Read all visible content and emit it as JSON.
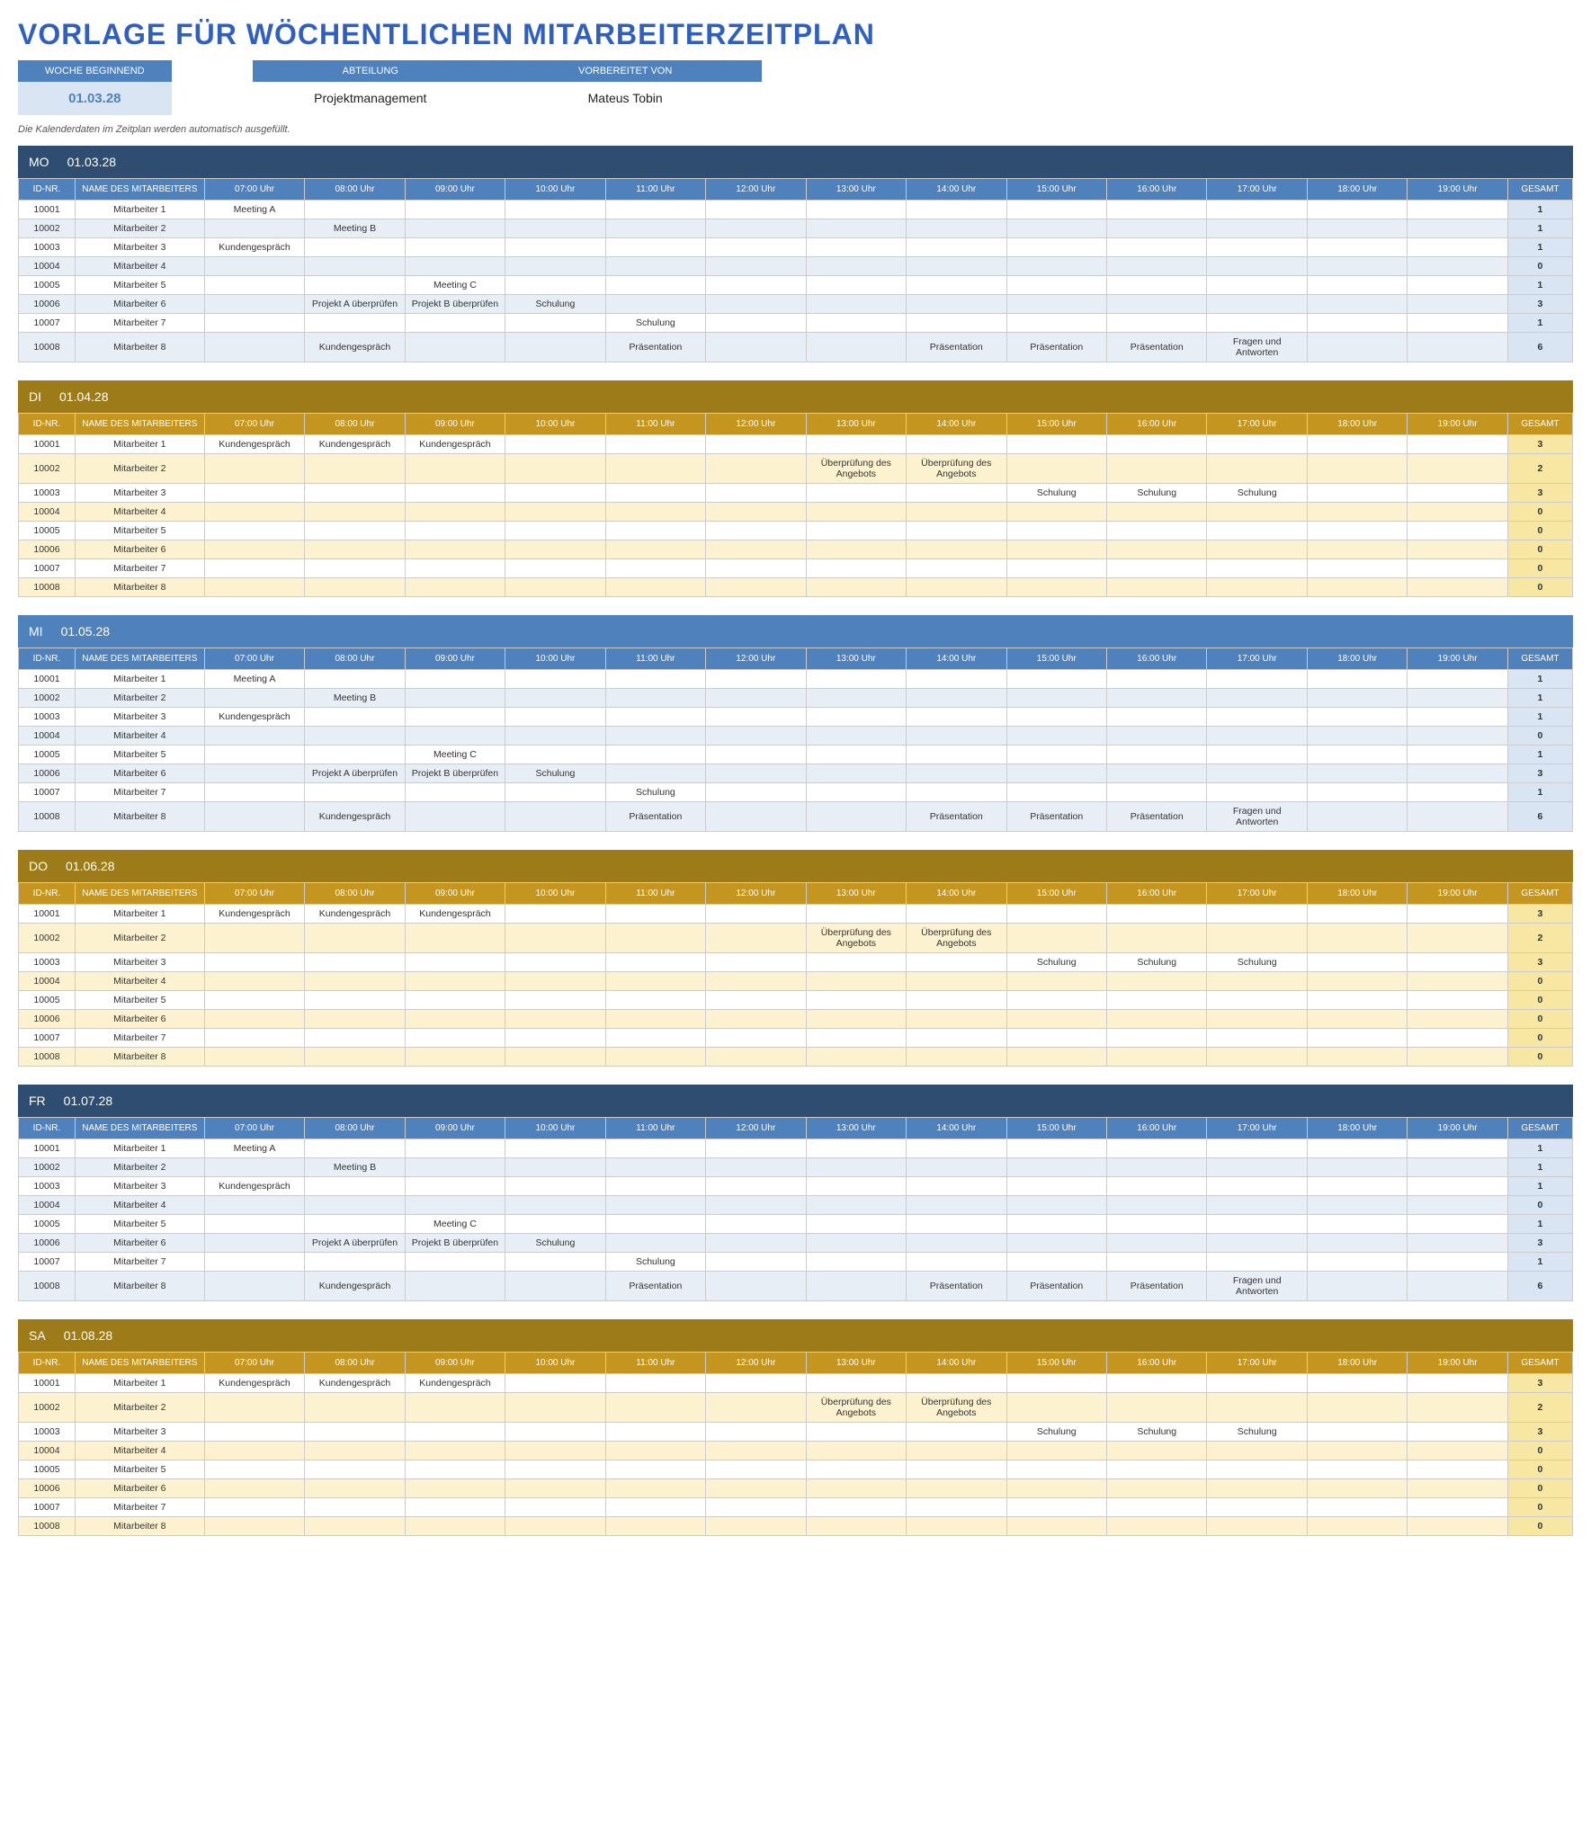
{
  "title": "VORLAGE FÜR WÖCHENTLICHEN MITARBEITERZEITPLAN",
  "header": {
    "week_label": "WOCHE BEGINNEND",
    "week_value": "01.03.28",
    "dept_label": "ABTEILUNG",
    "dept_value": "Projektmanagement",
    "prep_label": "VORBEREITET VON",
    "prep_value": "Mateus Tobin"
  },
  "note": "Die Kalenderdaten im Zeitplan werden automatisch ausgefüllt.",
  "columns": {
    "id": "ID-NR.",
    "name": "NAME DES MITARBEITERS",
    "hours": [
      "07:00 Uhr",
      "08:00 Uhr",
      "09:00 Uhr",
      "10:00 Uhr",
      "11:00 Uhr",
      "12:00 Uhr",
      "13:00 Uhr",
      "14:00 Uhr",
      "15:00 Uhr",
      "16:00 Uhr",
      "17:00 Uhr",
      "18:00 Uhr",
      "19:00 Uhr"
    ],
    "total": "GESAMT"
  },
  "employees": [
    {
      "id": "10001",
      "name": "Mitarbeiter 1"
    },
    {
      "id": "10002",
      "name": "Mitarbeiter 2"
    },
    {
      "id": "10003",
      "name": "Mitarbeiter 3"
    },
    {
      "id": "10004",
      "name": "Mitarbeiter 4"
    },
    {
      "id": "10005",
      "name": "Mitarbeiter 5"
    },
    {
      "id": "10006",
      "name": "Mitarbeiter 6"
    },
    {
      "id": "10007",
      "name": "Mitarbeiter 7"
    },
    {
      "id": "10008",
      "name": "Mitarbeiter 8"
    }
  ],
  "pattern_blue": [
    {
      "cells": [
        "Meeting A",
        "",
        "",
        "",
        "",
        "",
        "",
        "",
        "",
        "",
        "",
        "",
        ""
      ],
      "total": "1"
    },
    {
      "cells": [
        "",
        "Meeting B",
        "",
        "",
        "",
        "",
        "",
        "",
        "",
        "",
        "",
        "",
        ""
      ],
      "total": "1"
    },
    {
      "cells": [
        "Kundengespräch",
        "",
        "",
        "",
        "",
        "",
        "",
        "",
        "",
        "",
        "",
        "",
        ""
      ],
      "total": "1"
    },
    {
      "cells": [
        "",
        "",
        "",
        "",
        "",
        "",
        "",
        "",
        "",
        "",
        "",
        "",
        ""
      ],
      "total": "0"
    },
    {
      "cells": [
        "",
        "",
        "Meeting C",
        "",
        "",
        "",
        "",
        "",
        "",
        "",
        "",
        "",
        ""
      ],
      "total": "1"
    },
    {
      "cells": [
        "",
        "Projekt A überprüfen",
        "Projekt B überprüfen",
        "Schulung",
        "",
        "",
        "",
        "",
        "",
        "",
        "",
        "",
        ""
      ],
      "total": "3"
    },
    {
      "cells": [
        "",
        "",
        "",
        "",
        "Schulung",
        "",
        "",
        "",
        "",
        "",
        "",
        "",
        ""
      ],
      "total": "1"
    },
    {
      "cells": [
        "",
        "Kundengespräch",
        "",
        "",
        "Präsentation",
        "",
        "",
        "Präsentation",
        "Präsentation",
        "Präsentation",
        "Fragen und Antworten",
        "",
        ""
      ],
      "total": "6"
    }
  ],
  "pattern_gold": [
    {
      "cells": [
        "Kundengespräch",
        "Kundengespräch",
        "Kundengespräch",
        "",
        "",
        "",
        "",
        "",
        "",
        "",
        "",
        "",
        ""
      ],
      "total": "3"
    },
    {
      "cells": [
        "",
        "",
        "",
        "",
        "",
        "",
        "Überprüfung des Angebots",
        "Überprüfung des Angebots",
        "",
        "",
        "",
        "",
        ""
      ],
      "total": "2"
    },
    {
      "cells": [
        "",
        "",
        "",
        "",
        "",
        "",
        "",
        "",
        "Schulung",
        "Schulung",
        "Schulung",
        "",
        ""
      ],
      "total": "3"
    },
    {
      "cells": [
        "",
        "",
        "",
        "",
        "",
        "",
        "",
        "",
        "",
        "",
        "",
        "",
        ""
      ],
      "total": "0"
    },
    {
      "cells": [
        "",
        "",
        "",
        "",
        "",
        "",
        "",
        "",
        "",
        "",
        "",
        "",
        ""
      ],
      "total": "0"
    },
    {
      "cells": [
        "",
        "",
        "",
        "",
        "",
        "",
        "",
        "",
        "",
        "",
        "",
        "",
        ""
      ],
      "total": "0"
    },
    {
      "cells": [
        "",
        "",
        "",
        "",
        "",
        "",
        "",
        "",
        "",
        "",
        "",
        "",
        ""
      ],
      "total": "0"
    },
    {
      "cells": [
        "",
        "",
        "",
        "",
        "",
        "",
        "",
        "",
        "",
        "",
        "",
        "",
        ""
      ],
      "total": "0"
    }
  ],
  "days": [
    {
      "code": "MO",
      "date": "01.03.28",
      "theme": "blue",
      "title_class": "dark-blue",
      "pattern": "pattern_blue"
    },
    {
      "code": "DI",
      "date": "01.04.28",
      "theme": "gold",
      "title_class": "gold",
      "pattern": "pattern_gold"
    },
    {
      "code": "MI",
      "date": "01.05.28",
      "theme": "blue",
      "title_class": "mid-blue",
      "pattern": "pattern_blue"
    },
    {
      "code": "DO",
      "date": "01.06.28",
      "theme": "gold",
      "title_class": "gold",
      "pattern": "pattern_gold"
    },
    {
      "code": "FR",
      "date": "01.07.28",
      "theme": "blue",
      "title_class": "dark-blue",
      "pattern": "pattern_blue"
    },
    {
      "code": "SA",
      "date": "01.08.28",
      "theme": "gold",
      "title_class": "gold",
      "pattern": "pattern_gold"
    }
  ]
}
